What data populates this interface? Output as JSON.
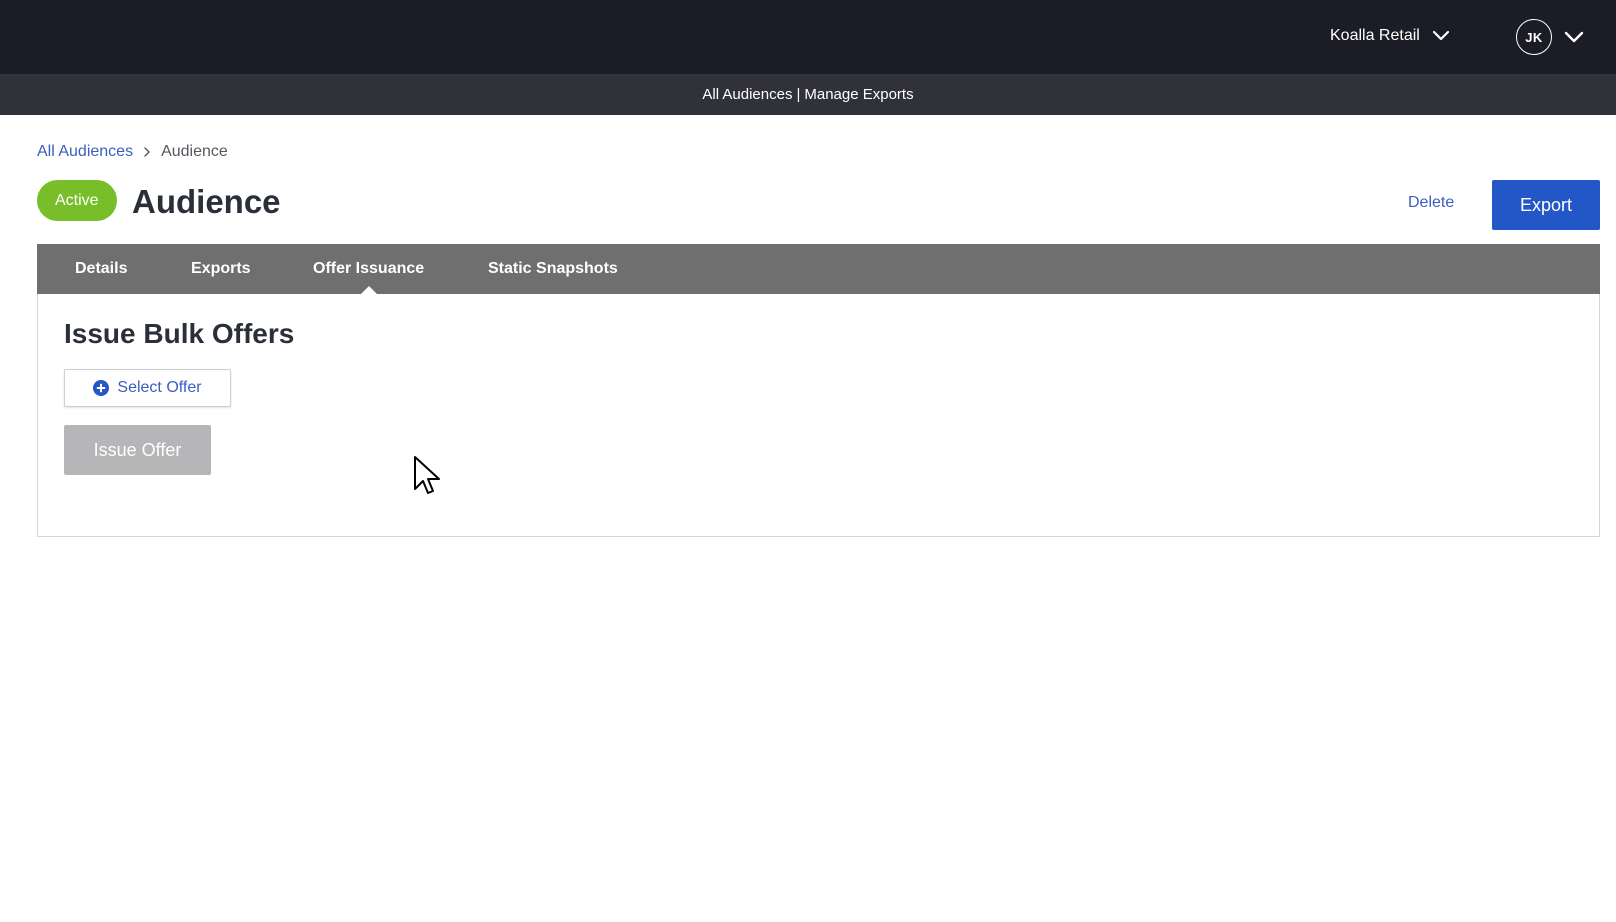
{
  "header": {
    "org_name": "Koalla Retail",
    "user_initials": "JK"
  },
  "subnav": {
    "all_audiences": "All Audiences",
    "separator": "|",
    "manage_exports": "Manage Exports"
  },
  "breadcrumb": {
    "parent": "All Audiences",
    "current": "Audience"
  },
  "page": {
    "status": "Active",
    "title": "Audience",
    "delete_label": "Delete",
    "export_label": "Export"
  },
  "tabs": [
    {
      "label": "Details",
      "active": false
    },
    {
      "label": "Exports",
      "active": false
    },
    {
      "label": "Offer Issuance",
      "active": true
    },
    {
      "label": "Static Snapshots",
      "active": false
    }
  ],
  "offer_issuance": {
    "section_title": "Issue Bulk Offers",
    "select_offer_label": "Select Offer",
    "issue_offer_label": "Issue Offer",
    "issue_offer_disabled": true
  },
  "colors": {
    "topbar": "#1b1c26",
    "subbar": "#313239",
    "accent": "#2356c7",
    "link": "#3b5fc0",
    "status_active": "#77be29",
    "tabbar": "#6f6f6f",
    "disabled_button": "#b6b6b9"
  },
  "icons": {
    "org_dropdown": "chevron-down-icon",
    "user_dropdown": "chevron-down-icon",
    "breadcrumb_separator": "chevron-right-icon",
    "select_offer": "plus-circle-icon",
    "pointer": "mouse-cursor-icon"
  }
}
